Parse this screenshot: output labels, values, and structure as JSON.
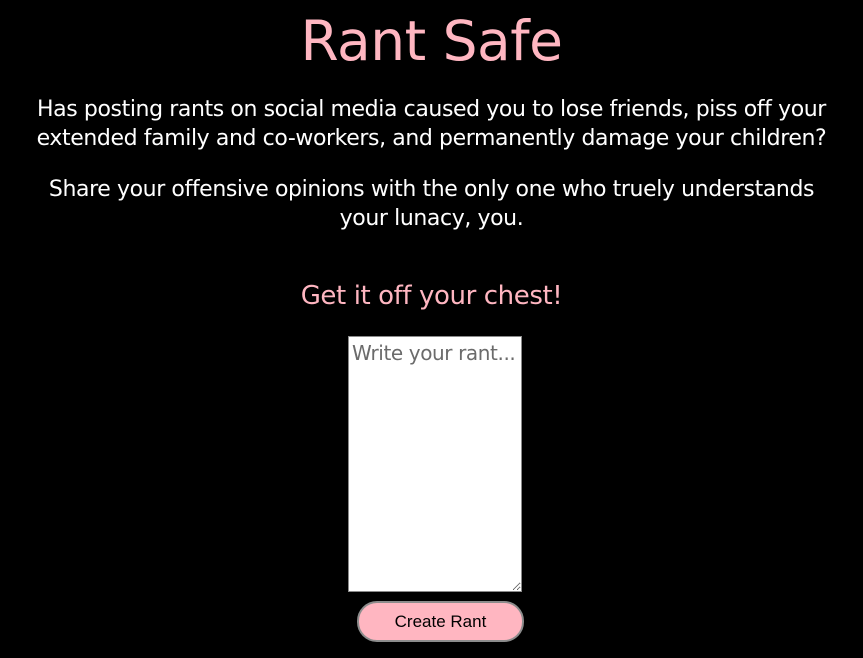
{
  "header": {
    "title": "Rant Safe"
  },
  "intro": {
    "text": "Has posting rants on social media caused you to lose friends, piss off your extended family and co-workers, and permanently damage your children?"
  },
  "share": {
    "text": "Share your offensive opinions with the only one who truely understands your lunacy, you."
  },
  "form": {
    "heading": "Get it off your chest!",
    "rant_input": {
      "value": "",
      "placeholder": "Write your rant..."
    },
    "submit_label": "Create Rant"
  },
  "colors": {
    "background": "#000000",
    "accent": "#ffb6c1",
    "text": "#ffffff"
  }
}
